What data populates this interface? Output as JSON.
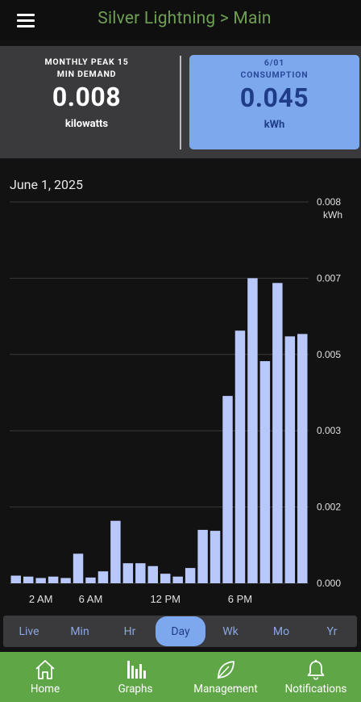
{
  "header": {
    "title": "Silver Lightning > Main",
    "menu_icon": "hamburger-menu-icon"
  },
  "summary": {
    "peak": {
      "label_line1": "MONTHLY PEAK 15",
      "label_line2": "MIN DEMAND",
      "value": "0.008",
      "unit": "kilowatts"
    },
    "consumption": {
      "label_line1": "6/01",
      "label_line2": "CONSUMPTION",
      "value": "0.045",
      "unit": "kWh"
    }
  },
  "chart": {
    "date": "June 1, 2025"
  },
  "chart_data": {
    "type": "bar",
    "title": "June 1, 2025",
    "ylabel": "kWh",
    "ylim": [
      0,
      0.008
    ],
    "y_ticks": [
      "0.000",
      "0.002",
      "0.003",
      "0.005",
      "0.007",
      "0.008"
    ],
    "x_tick_labels": [
      "2 AM",
      "6 AM",
      "12 PM",
      "6 PM"
    ],
    "categories": [
      "0",
      "1",
      "2",
      "3",
      "4",
      "5",
      "6",
      "7",
      "8",
      "9",
      "10",
      "11",
      "12",
      "13",
      "14",
      "15",
      "16",
      "17",
      "18",
      "19",
      "20",
      "21",
      "22",
      "23"
    ],
    "values": [
      0.00016,
      0.00014,
      0.00011,
      0.00014,
      0.00011,
      0.00062,
      0.00012,
      0.00025,
      0.00131,
      0.00042,
      0.00042,
      0.00036,
      0.0002,
      0.00014,
      0.00032,
      0.00112,
      0.0011,
      0.00393,
      0.0053,
      0.0064,
      0.00466,
      0.0063,
      0.00518,
      0.00523
    ],
    "bar_color": "#b9c8fb",
    "grid": true
  },
  "range_tabs": {
    "items": [
      {
        "label": "Live"
      },
      {
        "label": "Min"
      },
      {
        "label": "Hr"
      },
      {
        "label": "Day"
      },
      {
        "label": "Wk"
      },
      {
        "label": "Mo"
      },
      {
        "label": "Yr"
      }
    ],
    "selected": "Day"
  },
  "bottom_nav": {
    "items": [
      {
        "label": "Home",
        "icon": "home-icon"
      },
      {
        "label": "Graphs",
        "icon": "bar-chart-icon"
      },
      {
        "label": "Management",
        "icon": "leaf-icon"
      },
      {
        "label": "Notifications",
        "icon": "bell-icon"
      }
    ]
  },
  "colors": {
    "accent_blue": "#7ea8ee",
    "brand_green": "#5fa646",
    "title_green": "#6f9e55"
  }
}
